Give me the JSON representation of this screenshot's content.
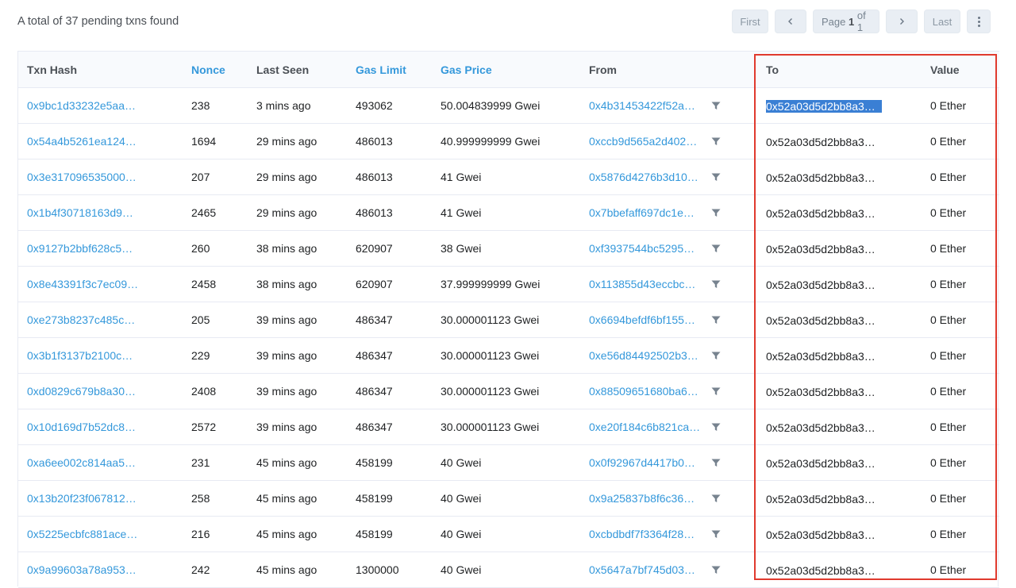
{
  "summary": "A total of 37 pending txns found",
  "pager": {
    "first": "First",
    "prev_icon": "chevron-left-icon",
    "page_prefix": "Page",
    "page_current": "1",
    "page_of": "of 1",
    "next_icon": "chevron-right-icon",
    "last": "Last",
    "more_icon": "more-vertical-icon"
  },
  "columns": {
    "txn_hash": "Txn Hash",
    "nonce": "Nonce",
    "last_seen": "Last Seen",
    "gas_limit": "Gas Limit",
    "gas_price": "Gas Price",
    "from": "From",
    "to": "To",
    "value": "Value"
  },
  "rows": [
    {
      "hash": "0x9bc1d33232e5aa…",
      "nonce": "238",
      "last_seen": "3 mins ago",
      "gas_limit": "493062",
      "gas_price": "50.004839999 Gwei",
      "from": "0x4b31453422f52a…",
      "to": "0x52a03d5d2bb8a3…",
      "value": "0 Ether"
    },
    {
      "hash": "0x54a4b5261ea124…",
      "nonce": "1694",
      "last_seen": "29 mins ago",
      "gas_limit": "486013",
      "gas_price": "40.999999999 Gwei",
      "from": "0xccb9d565a2d402…",
      "to": "0x52a03d5d2bb8a3…",
      "value": "0 Ether"
    },
    {
      "hash": "0x3e317096535000…",
      "nonce": "207",
      "last_seen": "29 mins ago",
      "gas_limit": "486013",
      "gas_price": "41 Gwei",
      "from": "0x5876d4276b3d10…",
      "to": "0x52a03d5d2bb8a3…",
      "value": "0 Ether"
    },
    {
      "hash": "0x1b4f30718163d9…",
      "nonce": "2465",
      "last_seen": "29 mins ago",
      "gas_limit": "486013",
      "gas_price": "41 Gwei",
      "from": "0x7bbefaff697dc1e…",
      "to": "0x52a03d5d2bb8a3…",
      "value": "0 Ether"
    },
    {
      "hash": "0x9127b2bbf628c5…",
      "nonce": "260",
      "last_seen": "38 mins ago",
      "gas_limit": "620907",
      "gas_price": "38 Gwei",
      "from": "0xf3937544bc5295…",
      "to": "0x52a03d5d2bb8a3…",
      "value": "0 Ether"
    },
    {
      "hash": "0x8e43391f3c7ec09…",
      "nonce": "2458",
      "last_seen": "38 mins ago",
      "gas_limit": "620907",
      "gas_price": "37.999999999 Gwei",
      "from": "0x113855d43eccbc…",
      "to": "0x52a03d5d2bb8a3…",
      "value": "0 Ether"
    },
    {
      "hash": "0xe273b8237c485c…",
      "nonce": "205",
      "last_seen": "39 mins ago",
      "gas_limit": "486347",
      "gas_price": "30.000001123 Gwei",
      "from": "0x6694befdf6bf155…",
      "to": "0x52a03d5d2bb8a3…",
      "value": "0 Ether"
    },
    {
      "hash": "0x3b1f3137b2100c…",
      "nonce": "229",
      "last_seen": "39 mins ago",
      "gas_limit": "486347",
      "gas_price": "30.000001123 Gwei",
      "from": "0xe56d84492502b3…",
      "to": "0x52a03d5d2bb8a3…",
      "value": "0 Ether"
    },
    {
      "hash": "0xd0829c679b8a30…",
      "nonce": "2408",
      "last_seen": "39 mins ago",
      "gas_limit": "486347",
      "gas_price": "30.000001123 Gwei",
      "from": "0x88509651680ba6…",
      "to": "0x52a03d5d2bb8a3…",
      "value": "0 Ether"
    },
    {
      "hash": "0x10d169d7b52dc8…",
      "nonce": "2572",
      "last_seen": "39 mins ago",
      "gas_limit": "486347",
      "gas_price": "30.000001123 Gwei",
      "from": "0xe20f184c6b821ca…",
      "to": "0x52a03d5d2bb8a3…",
      "value": "0 Ether"
    },
    {
      "hash": "0xa6ee002c814aa5…",
      "nonce": "231",
      "last_seen": "45 mins ago",
      "gas_limit": "458199",
      "gas_price": "40 Gwei",
      "from": "0x0f92967d4417b0…",
      "to": "0x52a03d5d2bb8a3…",
      "value": "0 Ether"
    },
    {
      "hash": "0x13b20f23f067812…",
      "nonce": "258",
      "last_seen": "45 mins ago",
      "gas_limit": "458199",
      "gas_price": "40 Gwei",
      "from": "0x9a25837b8f6c36…",
      "to": "0x52a03d5d2bb8a3…",
      "value": "0 Ether"
    },
    {
      "hash": "0x5225ecbfc881ace…",
      "nonce": "216",
      "last_seen": "45 mins ago",
      "gas_limit": "458199",
      "gas_price": "40 Gwei",
      "from": "0xcbdbdf7f3364f28…",
      "to": "0x52a03d5d2bb8a3…",
      "value": "0 Ether"
    },
    {
      "hash": "0x9a99603a78a953…",
      "nonce": "242",
      "last_seen": "45 mins ago",
      "gas_limit": "1300000",
      "gas_price": "40 Gwei",
      "from": "0x5647a7bf745d03…",
      "to": "0x52a03d5d2bb8a3…",
      "value": "0 Ether"
    }
  ],
  "colors": {
    "link": "#3498db",
    "highlight_box": "#e03a2e",
    "selection": "#3a7fd4"
  },
  "row_filter_icon": "filter-icon"
}
